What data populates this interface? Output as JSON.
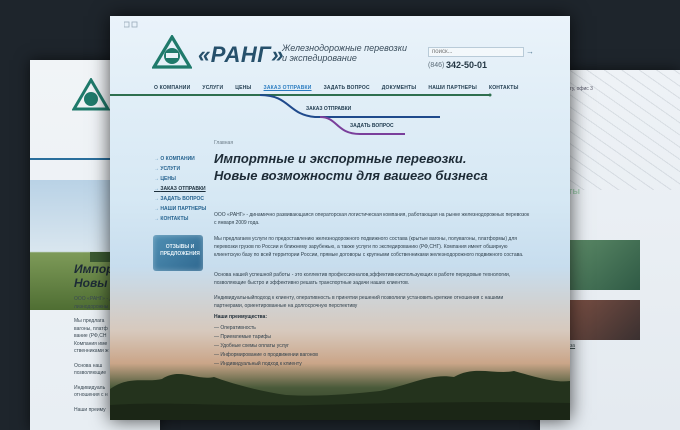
{
  "header": {
    "brand": "«РАНГ»",
    "tagline_line1": "Железнодорожные перевозки",
    "tagline_line2": "и экспедирование",
    "search_placeholder": "поиск...",
    "search_button": "→",
    "phone_prefix": "(846)",
    "phone": "342-50-01"
  },
  "nav": [
    {
      "label": "О КОМПАНИИ",
      "active": false
    },
    {
      "label": "УСЛУГИ",
      "active": false
    },
    {
      "label": "ЦЕНЫ",
      "active": false
    },
    {
      "label": "ЗАКАЗ ОТПРАВКИ",
      "active": true
    },
    {
      "label": "ЗАДАТЬ ВОПРОС",
      "active": false
    },
    {
      "label": "ДОКУМЕНТЫ",
      "active": false
    },
    {
      "label": "НАШИ ПАРТНЕРЫ",
      "active": false
    },
    {
      "label": "КОНТАКТЫ",
      "active": false
    }
  ],
  "tracks": {
    "label1": "ЗАКАЗ ОТПРАВКИ",
    "label2": "ЗАДАТЬ ВОПРОС",
    "colors": [
      "#2f6f4f",
      "#1f4a8c",
      "#7a3f9b"
    ]
  },
  "breadcrumb": "Главная",
  "sidebar": {
    "items": [
      {
        "label": "О КОМПАНИИ",
        "active": false
      },
      {
        "label": "УСЛУГИ",
        "active": false
      },
      {
        "label": "ЦЕНЫ",
        "active": false
      },
      {
        "label": "ЗАКАЗ ОТПРАВКИ",
        "active": true
      },
      {
        "label": "ЗАДАТЬ ВОПРОС",
        "active": false
      },
      {
        "label": "НАШИ ПАРТНЕРЫ",
        "active": false
      },
      {
        "label": "КОНТАКТЫ",
        "active": false
      }
    ],
    "banner_line1": "ОТЗЫВЫ И",
    "banner_line2": "ПРЕДЛОЖЕНИЯ"
  },
  "content": {
    "title_line1": "Импортные и экспортные перевозки.",
    "title_line2": "Новые возможности для вашего бизнеса",
    "p1": "ООО «РАНГ» - динамично развивающаяся операторская логистическая компания, работающая на рынке железнодорожных перевозок с января 2009 года.",
    "p2": "Мы предлагаем услуги по предоставлению железнодорожного подвижного состава (крытые вагоны, полувагоны, платформы) для перевозки грузов по России и ближнему зарубежью, а также услуги по экспедированию (РФ,СНГ). Компания имеет обширную клиентскую базу по всей территории России, прямые договоры с крупными собственниками железнодорожного подвижного состава.",
    "p3": "Основа нашей успешной работы - это коллектив профессионалов,эффективноиспользующих в работе передовые технологии, позволяющие быстро и эффективно решать транспортные задачи наших клиентов.",
    "p4": "Индивидуальныйподход к клиенту, оперативность в принятии решений позволили установить крепкие отношения с нашими партнерами, ориентированные на долгосрочную перспективу",
    "advantages_title": "Наши преимущества:",
    "advantages": [
      "Оперативность",
      "Приемлемые тарифы",
      "Удобные схемы оплаты услуг",
      "Информирование о продвижении вагонов",
      "Индивидуальный подход к клиенту"
    ]
  },
  "back_left": {
    "title_line1": "Импор",
    "title_line2": "Новы",
    "text_lines": [
      "ООО «РАНГ» - д",
      "лизнодорожны",
      "",
      "Мы предлага",
      "вагоны, платф",
      "вание (РФ,СН",
      "Компания име",
      "ственниками ж",
      "",
      "Основа наш",
      "позволяющие",
      "",
      "Индивидуаль",
      "отношения с н",
      "",
      "Наши преиму"
    ]
  },
  "back_right": {
    "text_line1": "гу, офис 3",
    "text_line2": "ты",
    "label": "за"
  }
}
